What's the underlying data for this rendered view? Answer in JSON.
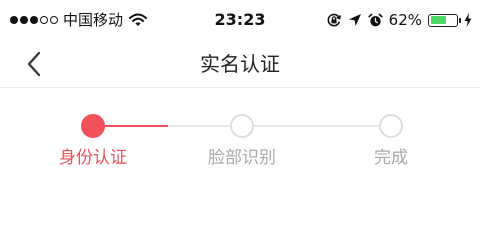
{
  "status_bar": {
    "carrier": "中国移动",
    "time": "23:23",
    "battery_percent": "62%",
    "battery_level": 0.62,
    "signal_strength": 3,
    "signal_max": 5,
    "icons": [
      "wifi-icon",
      "rotation-lock-icon",
      "location-arrow-icon",
      "alarm-clock-icon",
      "battery-icon",
      "charging-bolt-icon"
    ]
  },
  "nav": {
    "back_icon": "chevron-left-icon",
    "title": "实名认证"
  },
  "stepper": {
    "current_step": 1,
    "steps": [
      {
        "label": "身份认证",
        "state": "active"
      },
      {
        "label": "脸部识别",
        "state": "pending"
      },
      {
        "label": "完成",
        "state": "pending"
      }
    ]
  },
  "colors": {
    "accent": "#f0505a",
    "inactive_line": "#e6e6e6",
    "inactive_node": "#dcdcdc",
    "inactive_text": "#a8a8a8",
    "battery_fill": "#4cd964"
  }
}
